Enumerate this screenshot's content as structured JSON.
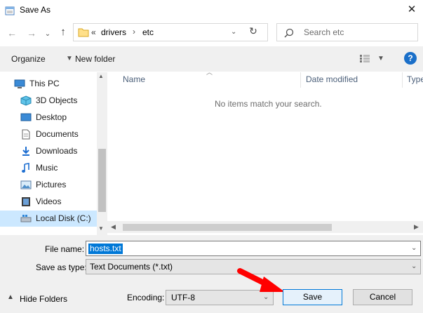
{
  "window": {
    "title": "Save As"
  },
  "nav": {
    "breadcrumb_prefix": "«",
    "path": [
      "drivers",
      "etc"
    ],
    "search_placeholder": "Search etc"
  },
  "toolbar": {
    "organize": "Organize",
    "new_folder": "New folder",
    "help": "?"
  },
  "sidebar": {
    "items": [
      {
        "label": "This PC",
        "icon": "pc-icon"
      },
      {
        "label": "3D Objects",
        "icon": "3d-objects-icon"
      },
      {
        "label": "Desktop",
        "icon": "desktop-icon"
      },
      {
        "label": "Documents",
        "icon": "documents-icon"
      },
      {
        "label": "Downloads",
        "icon": "downloads-icon"
      },
      {
        "label": "Music",
        "icon": "music-icon"
      },
      {
        "label": "Pictures",
        "icon": "pictures-icon"
      },
      {
        "label": "Videos",
        "icon": "videos-icon"
      },
      {
        "label": "Local Disk (C:)",
        "icon": "drive-icon"
      }
    ]
  },
  "filelist": {
    "columns": [
      "Name",
      "Date modified",
      "Type"
    ],
    "empty_message": "No items match your search."
  },
  "form": {
    "file_name_label": "File name:",
    "file_name_value": "hosts.txt",
    "save_type_label": "Save as type:",
    "save_type_value": "Text Documents (*.txt)",
    "hide_folders": "Hide Folders",
    "encoding_label": "Encoding:",
    "encoding_value": "UTF-8",
    "save": "Save",
    "cancel": "Cancel"
  },
  "colors": {
    "accent": "#0078d7",
    "selection": "#cce8ff",
    "annotation_arrow": "#ff0000"
  }
}
